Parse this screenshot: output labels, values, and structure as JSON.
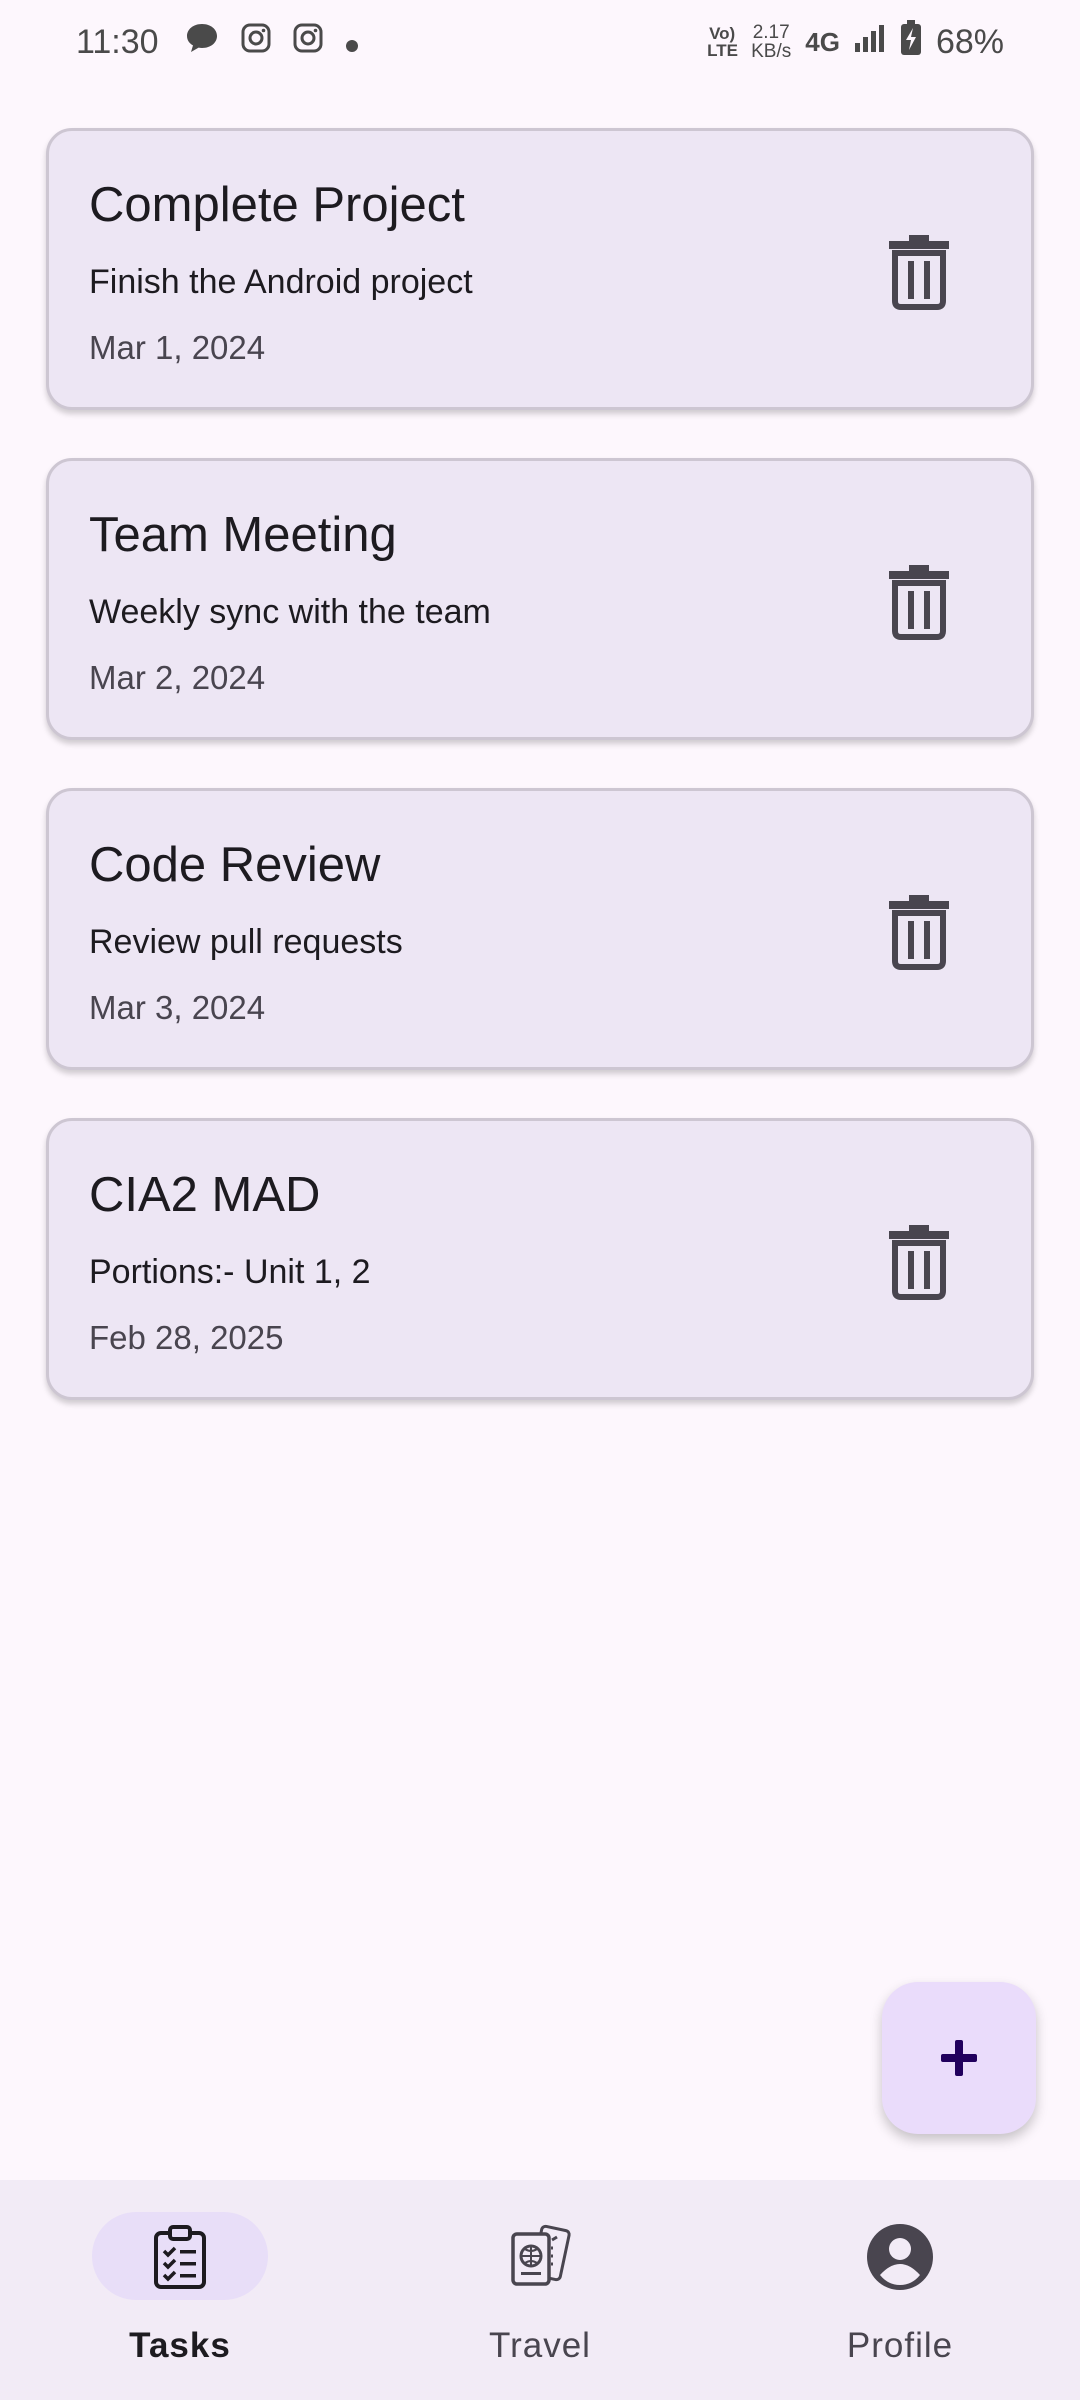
{
  "status_bar": {
    "time": "11:30",
    "volte": "Vo) LTE",
    "speed_value": "2.17",
    "speed_unit": "KB/s",
    "network": "4G",
    "battery": "68%",
    "icons": [
      "message-icon",
      "instagram-icon",
      "instagram-icon",
      "dot-icon",
      "signal-icon",
      "battery-charging-icon"
    ]
  },
  "tasks": [
    {
      "title": "Complete Project",
      "description": "Finish the Android project",
      "date": "Mar 1, 2024"
    },
    {
      "title": "Team Meeting",
      "description": "Weekly sync with the team",
      "date": "Mar 2, 2024"
    },
    {
      "title": "Code Review",
      "description": "Review pull requests",
      "date": "Mar 3, 2024"
    },
    {
      "title": "CIA2 MAD",
      "description": "Portions:- Unit 1, 2",
      "date": "Feb 28, 2025"
    }
  ],
  "fab": {
    "icon": "plus-icon"
  },
  "bottom_nav": {
    "items": [
      {
        "label": "Tasks",
        "icon": "clipboard-checklist-icon",
        "active": true
      },
      {
        "label": "Travel",
        "icon": "passport-ticket-icon",
        "active": false
      },
      {
        "label": "Profile",
        "icon": "account-circle-icon",
        "active": false
      }
    ]
  },
  "colors": {
    "background": "#fdf7fd",
    "card": "#ede6f4",
    "fab": "#eadcfb",
    "fab_icon": "#21005d",
    "nav_bar": "#f2ebf6",
    "nav_indicator": "#e8def8"
  }
}
